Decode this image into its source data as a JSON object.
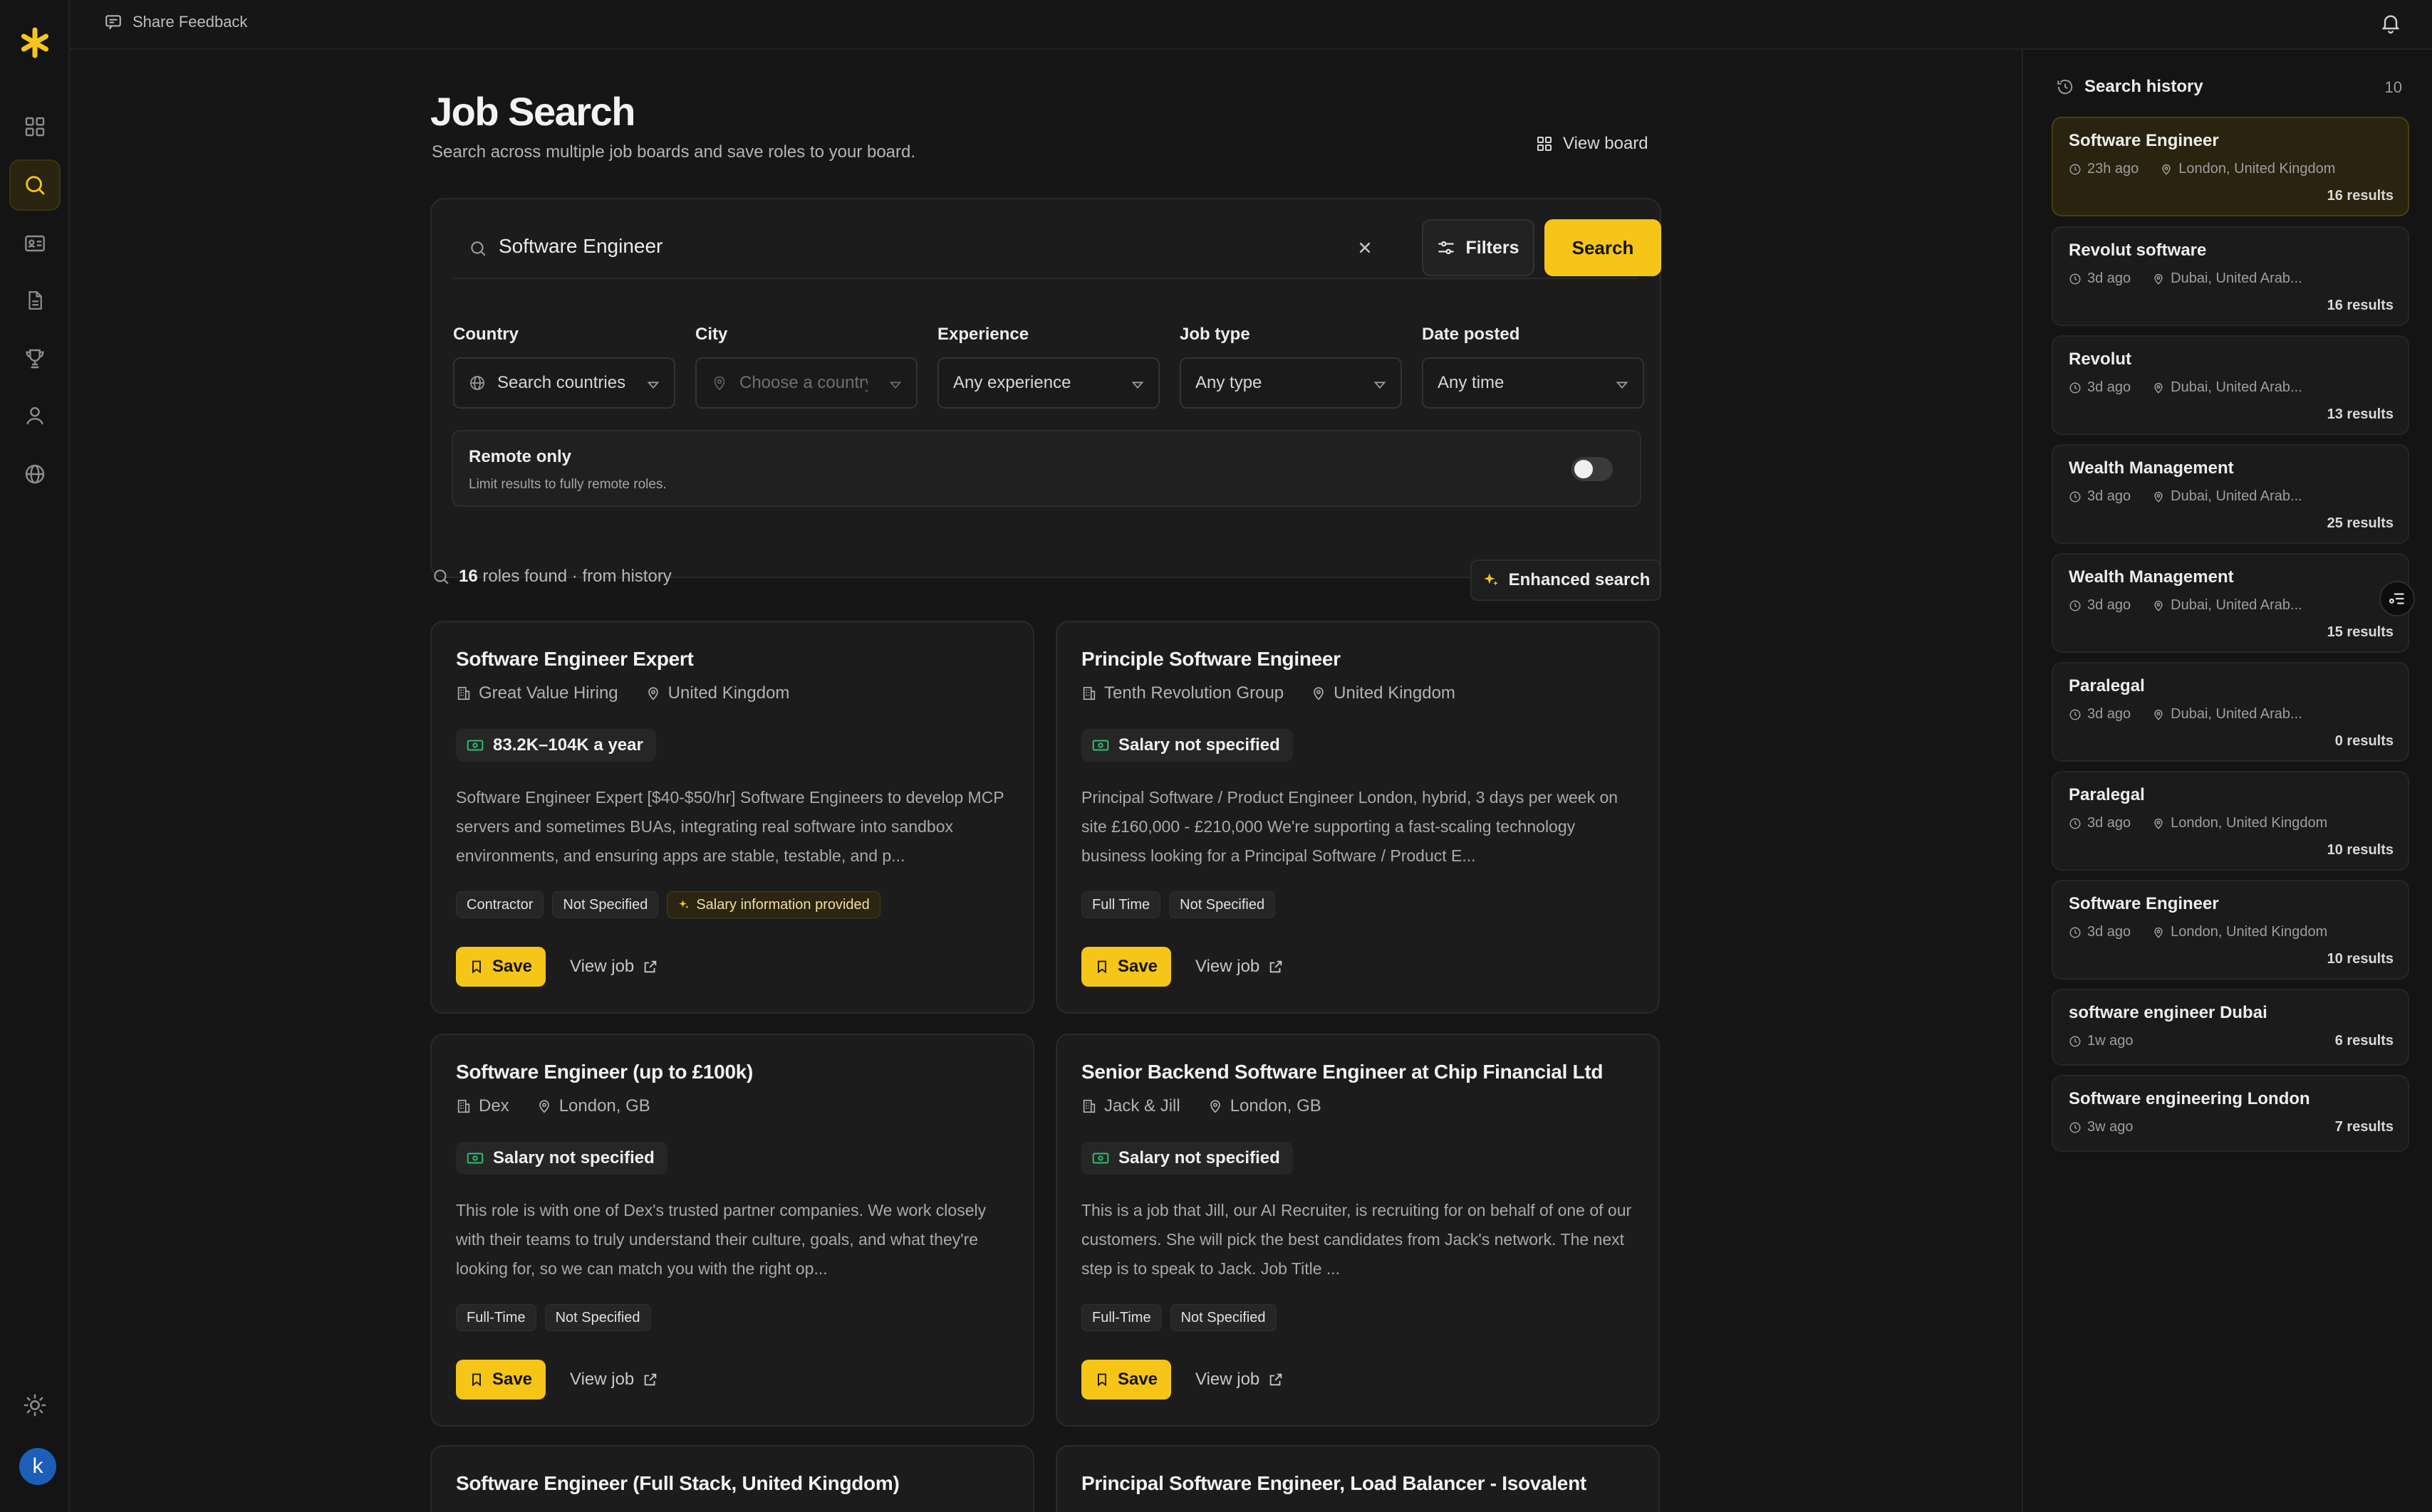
{
  "topbar": {
    "feedback_label": "Share Feedback"
  },
  "page": {
    "title": "Job Search",
    "subtitle": "Search across multiple job boards and save roles to your board.",
    "view_board_label": "View board"
  },
  "search": {
    "query": "Software Engineer",
    "filters_label": "Filters",
    "search_label": "Search"
  },
  "filters": {
    "country": {
      "label": "Country",
      "value": "Search countries"
    },
    "city": {
      "label": "City",
      "value": "Choose a country"
    },
    "experience": {
      "label": "Experience",
      "value": "Any experience"
    },
    "job_type": {
      "label": "Job type",
      "value": "Any type"
    },
    "date_posted": {
      "label": "Date posted",
      "value": "Any time"
    },
    "remote": {
      "title": "Remote only",
      "subtitle": "Limit results to fully remote roles.",
      "enabled": false
    }
  },
  "results": {
    "count": "16",
    "suffix": "roles found · from history",
    "enhanced_label": "Enhanced search"
  },
  "jobs": [
    {
      "title": "Software Engineer Expert",
      "company": "Great Value Hiring",
      "location": "United Kingdom",
      "salary": "83.2K–104K a year",
      "description": "Software Engineer Expert [$40-$50/hr] Software Engineers to develop MCP servers and sometimes BUAs, integrating real software into sandbox environments, and ensuring apps are stable, testable, and p...",
      "tags": [
        "Contractor",
        "Not Specified"
      ],
      "highlight_tag": "Salary information provided",
      "save_label": "Save",
      "view_label": "View job"
    },
    {
      "title": "Principle Software Engineer",
      "company": "Tenth Revolution Group",
      "location": "United Kingdom",
      "salary": "Salary not specified",
      "description": "Principal Software / Product Engineer London, hybrid, 3 days per week on site £160,000 - £210,000 We're supporting a fast-scaling technology business looking for a Principal Software / Product E...",
      "tags": [
        "Full Time",
        "Not Specified"
      ],
      "save_label": "Save",
      "view_label": "View job"
    },
    {
      "title": "Software Engineer (up to £100k)",
      "company": "Dex",
      "location": "London, GB",
      "salary": "Salary not specified",
      "description": "This role is with one of Dex's trusted partner companies. We work closely with their teams to truly understand their culture, goals, and what they're looking for, so we can match you with the right op...",
      "tags": [
        "Full-Time",
        "Not Specified"
      ],
      "save_label": "Save",
      "view_label": "View job"
    },
    {
      "title": "Senior Backend Software Engineer at Chip Financial Ltd",
      "company": "Jack & Jill",
      "location": "London, GB",
      "salary": "Salary not specified",
      "description": "This is a job that Jill, our AI Recruiter, is recruiting for on behalf of one of our customers. She will pick the best candidates from Jack's network. The next step is to speak to Jack. Job Title ...",
      "tags": [
        "Full-Time",
        "Not Specified"
      ],
      "save_label": "Save",
      "view_label": "View job"
    },
    {
      "title": "Software Engineer (Full Stack, United Kingdom)"
    },
    {
      "title": "Principal Software Engineer, Load Balancer - Isovalent"
    }
  ],
  "history": {
    "title": "Search history",
    "count": "10",
    "items": [
      {
        "title": "Software Engineer",
        "ago": "23h ago",
        "location": "London, United Kingdom",
        "results": "16 results"
      },
      {
        "title": "Revolut software",
        "ago": "3d ago",
        "location": "Dubai, United Arab...",
        "results": "16 results"
      },
      {
        "title": "Revolut",
        "ago": "3d ago",
        "location": "Dubai, United Arab...",
        "results": "13 results"
      },
      {
        "title": "Wealth Management",
        "ago": "3d ago",
        "location": "Dubai, United Arab...",
        "results": "25 results"
      },
      {
        "title": "Wealth Management",
        "ago": "3d ago",
        "location": "Dubai, United Arab...",
        "results": "15 results"
      },
      {
        "title": "Paralegal",
        "ago": "3d ago",
        "location": "Dubai, United Arab...",
        "results": "0 results"
      },
      {
        "title": "Paralegal",
        "ago": "3d ago",
        "location": "London, United Kingdom",
        "results": "10 results"
      },
      {
        "title": "Software Engineer",
        "ago": "3d ago",
        "location": "London, United Kingdom",
        "results": "10 results"
      },
      {
        "title": "software engineer Dubai",
        "ago": "1w ago",
        "results": "6 results"
      },
      {
        "title": "Software engineering London",
        "ago": "3w ago",
        "results": "7 results"
      }
    ]
  },
  "user": {
    "initial": "k"
  },
  "colors": {
    "accent": "#f5c518",
    "background": "#161616",
    "card": "#1c1c1c"
  },
  "icons": {
    "rail": [
      "dashboard-icon",
      "search-icon",
      "id-card-icon",
      "document-icon",
      "trophy-icon",
      "user-icon",
      "globe-icon",
      "sun-icon"
    ]
  }
}
